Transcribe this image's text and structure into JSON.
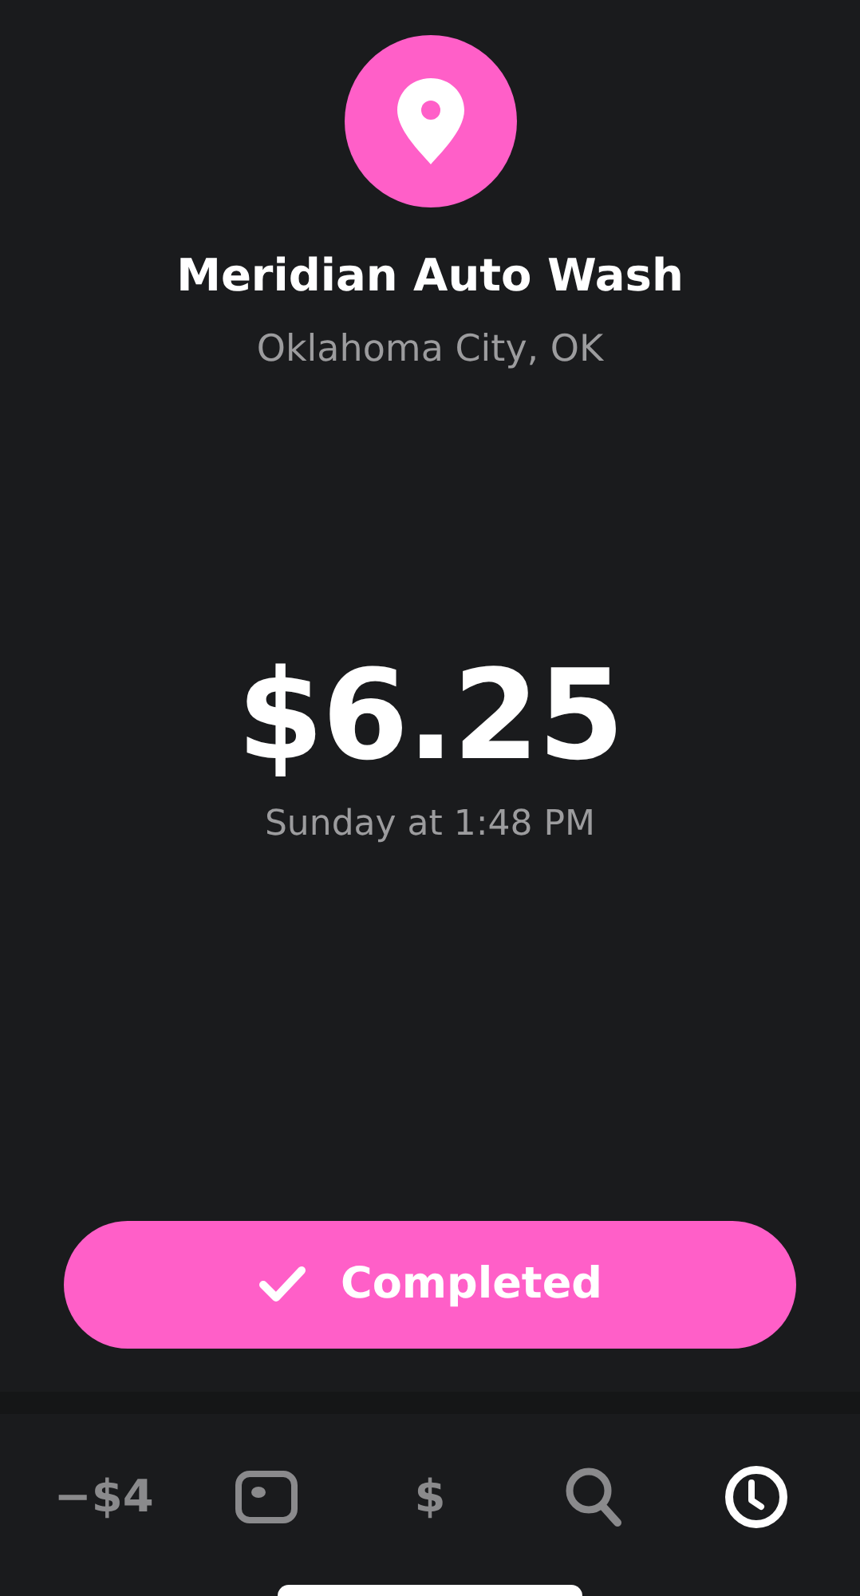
{
  "merchant": {
    "name": "Meridian Auto Wash",
    "location": "Oklahoma City, OK"
  },
  "payment": {
    "amount": "$6.25",
    "time": "Sunday at 1:48 PM"
  },
  "status_button": {
    "label": "Completed"
  },
  "tab_bar": [
    {
      "kind": "text",
      "label": "−$4",
      "selected": false
    },
    {
      "kind": "card",
      "selected": false
    },
    {
      "kind": "text",
      "label": "$",
      "selected": false
    },
    {
      "kind": "search",
      "selected": false
    },
    {
      "kind": "clock",
      "selected": true
    }
  ]
}
